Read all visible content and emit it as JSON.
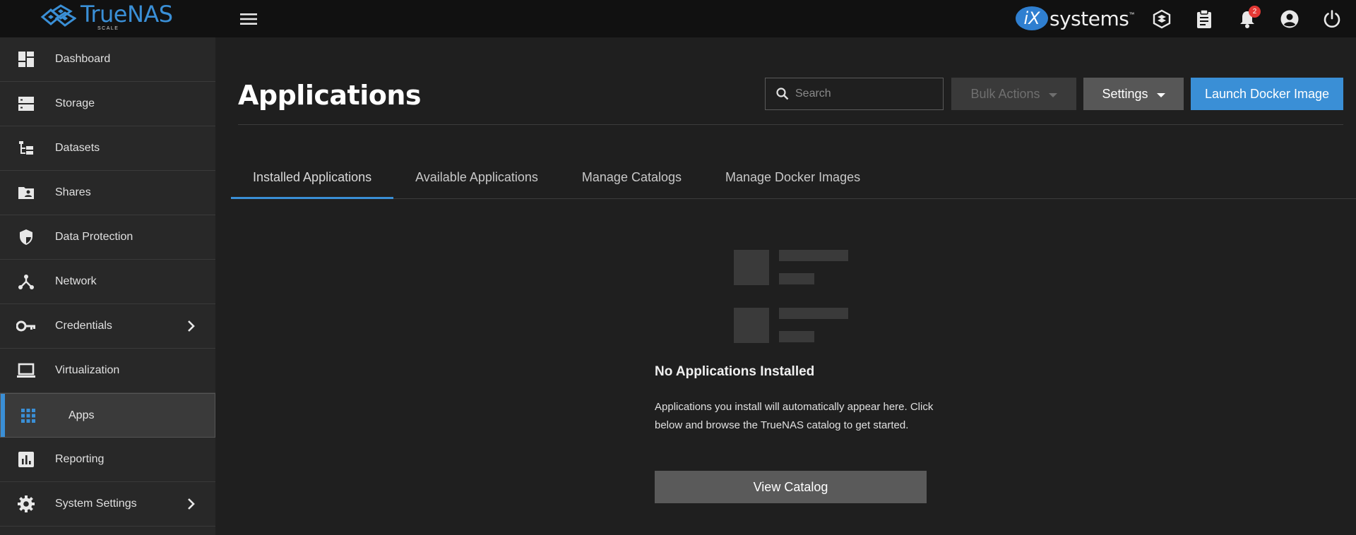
{
  "brand": {
    "name": "TrueNAS",
    "edition": "SCALE",
    "vendor_prefix": "iX",
    "vendor_text": "systems",
    "vendor_tm": "™"
  },
  "topbar": {
    "notification_count": "2"
  },
  "sidebar": {
    "items": [
      {
        "label": "Dashboard",
        "icon": "dashboard-icon",
        "has_submenu": false
      },
      {
        "label": "Storage",
        "icon": "storage-icon",
        "has_submenu": false
      },
      {
        "label": "Datasets",
        "icon": "datasets-icon",
        "has_submenu": false
      },
      {
        "label": "Shares",
        "icon": "shares-icon",
        "has_submenu": false
      },
      {
        "label": "Data Protection",
        "icon": "shield-icon",
        "has_submenu": false
      },
      {
        "label": "Network",
        "icon": "network-icon",
        "has_submenu": false
      },
      {
        "label": "Credentials",
        "icon": "key-icon",
        "has_submenu": true
      },
      {
        "label": "Virtualization",
        "icon": "laptop-icon",
        "has_submenu": false
      },
      {
        "label": "Apps",
        "icon": "apps-grid-icon",
        "has_submenu": false,
        "active": true
      },
      {
        "label": "Reporting",
        "icon": "chart-icon",
        "has_submenu": false
      },
      {
        "label": "System Settings",
        "icon": "gear-icon",
        "has_submenu": true
      }
    ]
  },
  "main": {
    "title": "Applications",
    "search": {
      "placeholder": "Search",
      "value": ""
    },
    "buttons": {
      "bulk": "Bulk Actions",
      "settings": "Settings",
      "launch": "Launch Docker Image"
    },
    "tabs": [
      {
        "label": "Installed Applications",
        "active": true
      },
      {
        "label": "Available Applications"
      },
      {
        "label": "Manage Catalogs"
      },
      {
        "label": "Manage Docker Images"
      }
    ],
    "empty": {
      "title": "No Applications Installed",
      "text": "Applications you install will automatically appear here. Click below and browse the TrueNAS catalog to get started.",
      "button": "View Catalog"
    }
  },
  "colors": {
    "accent": "#3a8fd6",
    "topbar": "#111111",
    "sidebar": "#282828",
    "main": "#1f1f1f",
    "badge": "#e53935"
  }
}
